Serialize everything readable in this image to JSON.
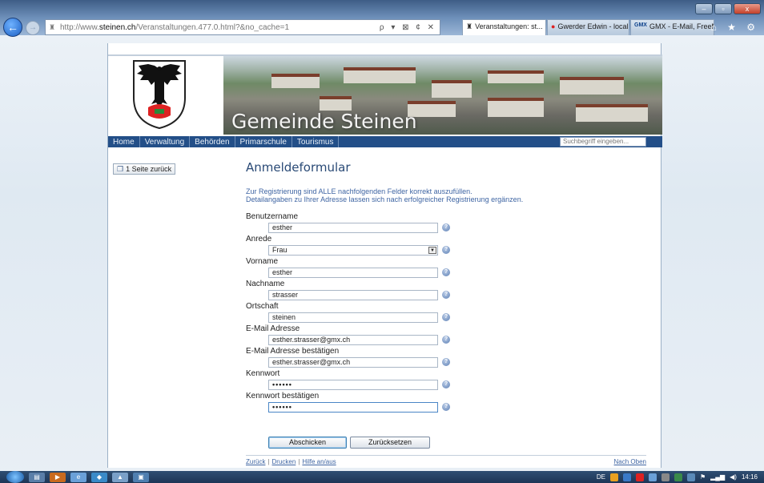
{
  "browser": {
    "url_prefix": "http://www.",
    "url_domain": "steinen.ch",
    "url_rest": "/Veranstaltungen.477.0.html?&no_cache=1",
    "tools": "ρ ▾ ⊠ ¢ ✕",
    "tabs": [
      {
        "label": "Veranstaltungen: st...",
        "close": "×"
      },
      {
        "label": "Gwerder Edwin - local..."
      },
      {
        "label": "GMX - E-Mail, FreeMai..."
      }
    ],
    "right_icons": "⌂ ★ ⚙"
  },
  "site": {
    "banner_title": "Gemeinde Steinen",
    "nav": [
      "Home",
      "Verwaltung",
      "Behörden",
      "Primarschule",
      "Tourismus"
    ],
    "search_placeholder": "Suchbegriff eingeben..."
  },
  "sidebar": {
    "back_label": "1 Seite zurück"
  },
  "form": {
    "title": "Anmeldeformular",
    "intro_line1": "Zur Registrierung sind ALLE nachfolgenden Felder korrekt auszufüllen.",
    "intro_line2": "Detailangaben zu Ihrer Adresse lassen sich nach erfolgreicher Registrierung ergänzen.",
    "fields": [
      {
        "label": "Benutzername",
        "value": "esther"
      },
      {
        "label": "Anrede",
        "value": "Frau"
      },
      {
        "label": "Vorname",
        "value": "esther"
      },
      {
        "label": "Nachname",
        "value": "strasser"
      },
      {
        "label": "Ortschaft",
        "value": "steinen"
      },
      {
        "label": "E-Mail Adresse",
        "value": "esther.strasser@gmx.ch"
      },
      {
        "label": "E-Mail Adresse bestätigen",
        "value": "esther.strasser@gmx.ch"
      },
      {
        "label": "Kennwort",
        "value": "••••••"
      },
      {
        "label": "Kennwort bestätigen",
        "value": "••••••"
      }
    ],
    "submit_label": "Abschicken",
    "reset_label": "Zurücksetzen"
  },
  "footer": {
    "back": "Zurück",
    "print": "Drucken",
    "help": "Hilfe an/aus",
    "top": "Nach Oben"
  },
  "taskbar": {
    "lang": "DE",
    "time": "14:16"
  },
  "colors": {
    "nav_bg": "#234f88",
    "title_color": "#2a4a76",
    "link_color": "#3f65a3"
  }
}
